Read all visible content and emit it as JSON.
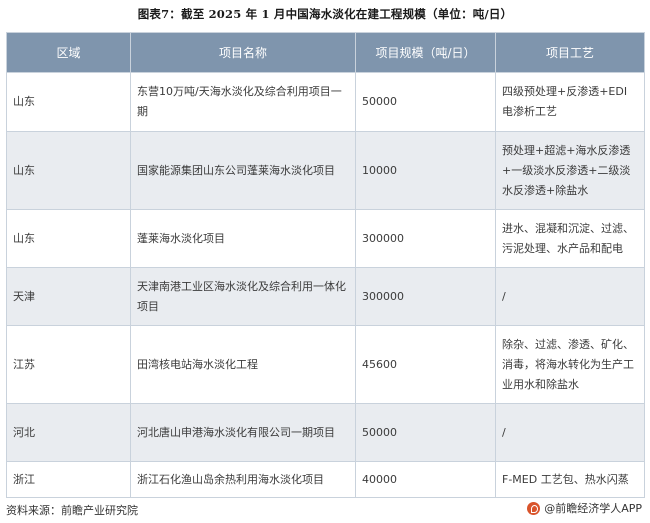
{
  "title": "图表7：截至 2025 年 1 月中国海水淡化在建工程规模（单位：吨/日）",
  "table": {
    "headers": [
      "区域",
      "项目名称",
      "项目规模（吨/日）",
      "项目工艺"
    ],
    "rows": [
      {
        "region": "山东",
        "name": "东营10万吨/天海水淡化及综合利用项目一期",
        "scale": "50000",
        "process": "四级预处理+反渗透+EDI电渗析工艺"
      },
      {
        "region": "山东",
        "name": "国家能源集团山东公司蓬莱海水淡化项目",
        "scale": "10000",
        "process": "预处理+超滤+海水反渗透+一级淡水反渗透+二级淡水反渗透+除盐水"
      },
      {
        "region": "山东",
        "name": "蓬莱海水淡化项目",
        "scale": "300000",
        "process": "进水、混凝和沉淀、过滤、污泥处理、水产品和配电"
      },
      {
        "region": "天津",
        "name": "天津南港工业区海水淡化及综合利用一体化项目",
        "scale": "300000",
        "process": "/"
      },
      {
        "region": "江苏",
        "name": "田湾核电站海水淡化工程",
        "scale": "45600",
        "process": "除杂、过滤、渗透、矿化、消毒，将海水转化为生产工业用水和除盐水"
      },
      {
        "region": "河北",
        "name": "河北唐山申港海水淡化有限公司一期项目",
        "scale": "50000",
        "process": "/"
      },
      {
        "region": "浙江",
        "name": "浙江石化渔山岛余热利用海水淡化项目",
        "scale": "40000",
        "process": "F-MED 工艺包、热水闪蒸"
      }
    ]
  },
  "footer": {
    "source": "资料来源：前瞻产业研究院",
    "brand": "@前瞻经济学人APP"
  }
}
